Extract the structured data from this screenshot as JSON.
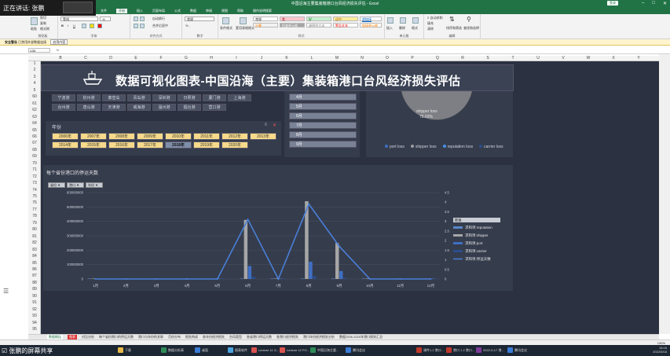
{
  "speaking_banner": {
    "label": "正在讲话: 张鹏"
  },
  "window": {
    "title": "中国沿海主要集装箱港口台风经济损失评估 - Excel",
    "login": "登录"
  },
  "ribbon_tabs": [
    "文件",
    "开始",
    "插入",
    "页面布局",
    "公式",
    "数据",
    "审阅",
    "视图",
    "帮助",
    "操作说明搜索"
  ],
  "ribbon": {
    "clipboard": {
      "paste": "粘贴",
      "cut": "剪切",
      "copy": "复制",
      "format_painter": "格式刷",
      "group": "剪贴板"
    },
    "font": {
      "name": "等线",
      "size": "11",
      "group": "字体"
    },
    "alignment": {
      "wrap": "自动换行",
      "merge": "合并后居中",
      "group": "对齐方式"
    },
    "number": {
      "format": "常规",
      "group": "数字"
    },
    "styles": {
      "conditional": "条件格式",
      "as_table": "套用表格格式",
      "cells": [
        "常规",
        "差",
        "好",
        "适中",
        "超链接",
        "计算",
        "检查单元格",
        "解释性文本",
        "警告文本",
        "链接单元格"
      ],
      "group": "样式"
    },
    "cells": {
      "insert": "插入",
      "delete": "删除",
      "format": "格式",
      "group": "单元格"
    },
    "editing": {
      "autosum": "自动求和",
      "fill": "填充",
      "clear": "清除",
      "sort": "排序和筛选",
      "find": "查找和选择",
      "group": "编辑"
    }
  },
  "security_bar": {
    "label": "安全警告",
    "message": "已禁用外部数据连接",
    "button": "启用内容"
  },
  "formula_bar": {
    "name_box": "U36",
    "fx": "fx"
  },
  "columns": [
    "B",
    "C",
    "D",
    "E",
    "F",
    "G",
    "H",
    "I",
    "J",
    "K",
    "L",
    "M",
    "N",
    "O",
    "P",
    "Q",
    "R",
    "S",
    "T",
    "U",
    "V",
    "W",
    "X",
    "Y"
  ],
  "rows": [
    "1",
    "2",
    "3",
    "4",
    "5",
    "60",
    "61",
    "62",
    "63",
    "64",
    "65",
    "66",
    "67",
    "68",
    "69",
    "70",
    "71",
    "72",
    "73",
    "74",
    "75",
    "76",
    "77",
    "78",
    "79",
    "80",
    "81",
    "82",
    "83",
    "84",
    "85",
    "86",
    "87",
    "88",
    "89",
    "90",
    "91",
    "92",
    "93",
    "94",
    "95"
  ],
  "dashboard_title": "数据可视化图表-中国沿海（主要）集装箱港口台风经济损失评估",
  "port_slicer": [
    "宁波港",
    "钦州港",
    "秦皇岛",
    "青岛港",
    "深圳港",
    "日照港",
    "厦门港",
    "上海港",
    "台州港",
    "唐山港",
    "天津港",
    "威海港",
    "温州港",
    "烟台港",
    "营口港"
  ],
  "year_slicer": {
    "label": "年份",
    "items": [
      "2006年",
      "2007年",
      "2008年",
      "2009年",
      "2010年",
      "2011年",
      "2012年",
      "2013年",
      "2014年",
      "2015年",
      "2016年",
      "2017年",
      "2018年",
      "2019年",
      "2020年"
    ],
    "selected": "2018年"
  },
  "month_slicer": [
    "4月",
    "5月",
    "6月",
    "7月",
    "8月",
    "9月"
  ],
  "pie": {
    "label": "shipper loss",
    "percent": "75.03%",
    "legend": [
      "port loss",
      "shipper loss",
      "reputation loss",
      "carrier loss"
    ],
    "colors": [
      "#3a6fc4",
      "#9c9c9c",
      "#4a8fe8",
      "#2c4d8a"
    ]
  },
  "chart_data": {
    "type": "bar",
    "title": "每个省份港口的停运天数",
    "filters": [
      "省份",
      "港口",
      "年份"
    ],
    "categories": [
      "1月",
      "2月",
      "3月",
      "4月",
      "5月",
      "6月",
      "7月",
      "8月",
      "9月",
      "10月",
      "11月",
      "12月"
    ],
    "ylim": [
      0,
      600000000
    ],
    "y_ticks": [
      "0",
      "100000000",
      "200000000",
      "300000000",
      "400000000",
      "500000000",
      "600000000"
    ],
    "y2lim": [
      0,
      4.5
    ],
    "y2_ticks": [
      "0",
      "0.5",
      "1",
      "1.5",
      "2",
      "2.5",
      "3",
      "3.5",
      "4",
      "4.5"
    ],
    "legend_title": "数值",
    "series": [
      {
        "name": "求和项:reputation",
        "kind": "bar",
        "color": "#5b86c8",
        "values": [
          0,
          0,
          0,
          0,
          0,
          0,
          0,
          0,
          0,
          0,
          0,
          0
        ]
      },
      {
        "name": "求和项:shipper",
        "kind": "bar",
        "color": "#a6a6a6",
        "values": [
          0,
          0,
          0,
          0,
          0,
          410000000,
          0,
          540000000,
          250000000,
          0,
          0,
          0
        ]
      },
      {
        "name": "求和项:port",
        "kind": "bar",
        "color": "#3f6fc4",
        "values": [
          0,
          0,
          0,
          0,
          0,
          90000000,
          0,
          120000000,
          55000000,
          0,
          0,
          0
        ]
      },
      {
        "name": "求和项:carrier",
        "kind": "bar",
        "color": "#2c4d8a",
        "values": [
          0,
          0,
          0,
          0,
          0,
          15000000,
          0,
          20000000,
          8000000,
          0,
          0,
          0
        ]
      },
      {
        "name": "求和项:停运天数",
        "kind": "line",
        "color": "#4a7fd8",
        "values": [
          0,
          0,
          0,
          0,
          0,
          3.1,
          0,
          3.9,
          1.7,
          0,
          0,
          0
        ]
      }
    ]
  },
  "sheet_tabs": [
    "数据概括",
    "图表",
    "对比分析",
    "每个省份港口的停运天数",
    "港口与年份的关联",
    "月份分布",
    "损失构成",
    "各年份经济损失",
    "台风类型",
    "各省港口停运天数",
    "各港口经济损失",
    "港口年份经济损失分析",
    "数据2006-2020年港口损失汇总"
  ],
  "sheet_tabs_active": "数据概括",
  "status": {
    "zoom": "130%"
  },
  "share_label": "张鹏的屏幕共享",
  "taskbar": [
    "下载",
    "数据分析表",
    "桌面",
    "图表软件",
    "Lecture 11 G...",
    "Lecture 12 FO...",
    "中国沿海主要...",
    "腾讯会议",
    "课件1.2 港口...",
    "港口 1.2 港口...",
    "2022-5-17 港...",
    "腾讯会议"
  ],
  "clock": {
    "time": "16:16",
    "date": "2022/5/18"
  }
}
